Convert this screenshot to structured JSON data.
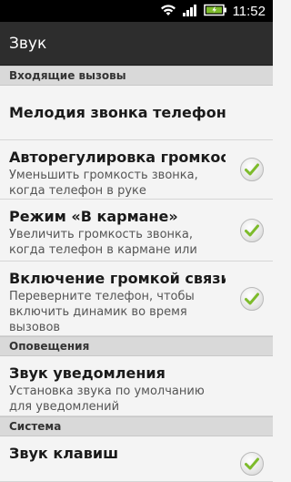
{
  "status_bar": {
    "time": "11:52",
    "icons": [
      "wifi-icon",
      "signal-icon",
      "battery-icon"
    ]
  },
  "app": {
    "title": "Звук"
  },
  "sections": [
    {
      "header": "Входящие вызовы",
      "items": [
        {
          "title": "Мелодия звонка телефона",
          "summary": ""
        },
        {
          "title": "Авторегулировка громкости звонка",
          "summary": "Уменьшить громкость звонка, когда телефон в руке",
          "checked": true
        },
        {
          "title": "Режим «В кармане»",
          "summary": "Увеличить громкость звонка, когда телефон в кармане или сумке",
          "checked": true
        },
        {
          "title": "Включение громкой связи переворотом",
          "summary": "Переверните телефон, чтобы включить динамик во время вызовов",
          "checked": true
        }
      ]
    },
    {
      "header": "Оповещения",
      "items": [
        {
          "title": "Звук уведомления",
          "summary": "Установка звука по умолчанию для уведомлений"
        }
      ]
    },
    {
      "header": "Система",
      "items": [
        {
          "title": "Звук клавиш",
          "checked": true
        }
      ]
    }
  ],
  "colors": {
    "check_accent": "#7dbb2b",
    "title_bar": "#2d2d2d",
    "section_bg": "#d9d9d9"
  }
}
